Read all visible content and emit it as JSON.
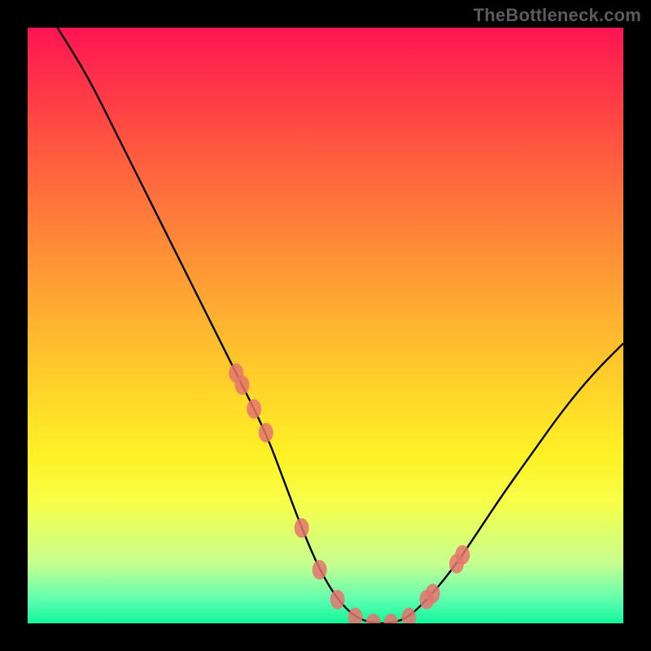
{
  "watermark": "TheBottleneck.com",
  "chart_data": {
    "type": "line",
    "title": "",
    "xlabel": "",
    "ylabel": "",
    "xlim": [
      0,
      100
    ],
    "ylim": [
      0,
      100
    ],
    "x": [
      5,
      10,
      15,
      20,
      25,
      30,
      35,
      40,
      43,
      46,
      49,
      52,
      55,
      58,
      61,
      64,
      68,
      72,
      76,
      80,
      85,
      90,
      95,
      100
    ],
    "values": [
      100,
      92,
      82,
      72,
      62,
      52,
      42,
      32,
      24,
      16,
      9,
      4,
      1,
      0,
      0,
      1,
      5,
      10,
      16,
      22,
      29,
      36,
      42,
      47
    ],
    "marker_points_x": [
      35,
      36,
      38,
      40,
      46,
      49,
      52,
      55,
      58,
      61,
      64,
      67,
      68,
      72,
      73
    ],
    "colors": {
      "gradient_top": "#ff1452",
      "gradient_bottom": "#10f59b",
      "curve": "#000000",
      "markers": "#e5746d"
    }
  }
}
